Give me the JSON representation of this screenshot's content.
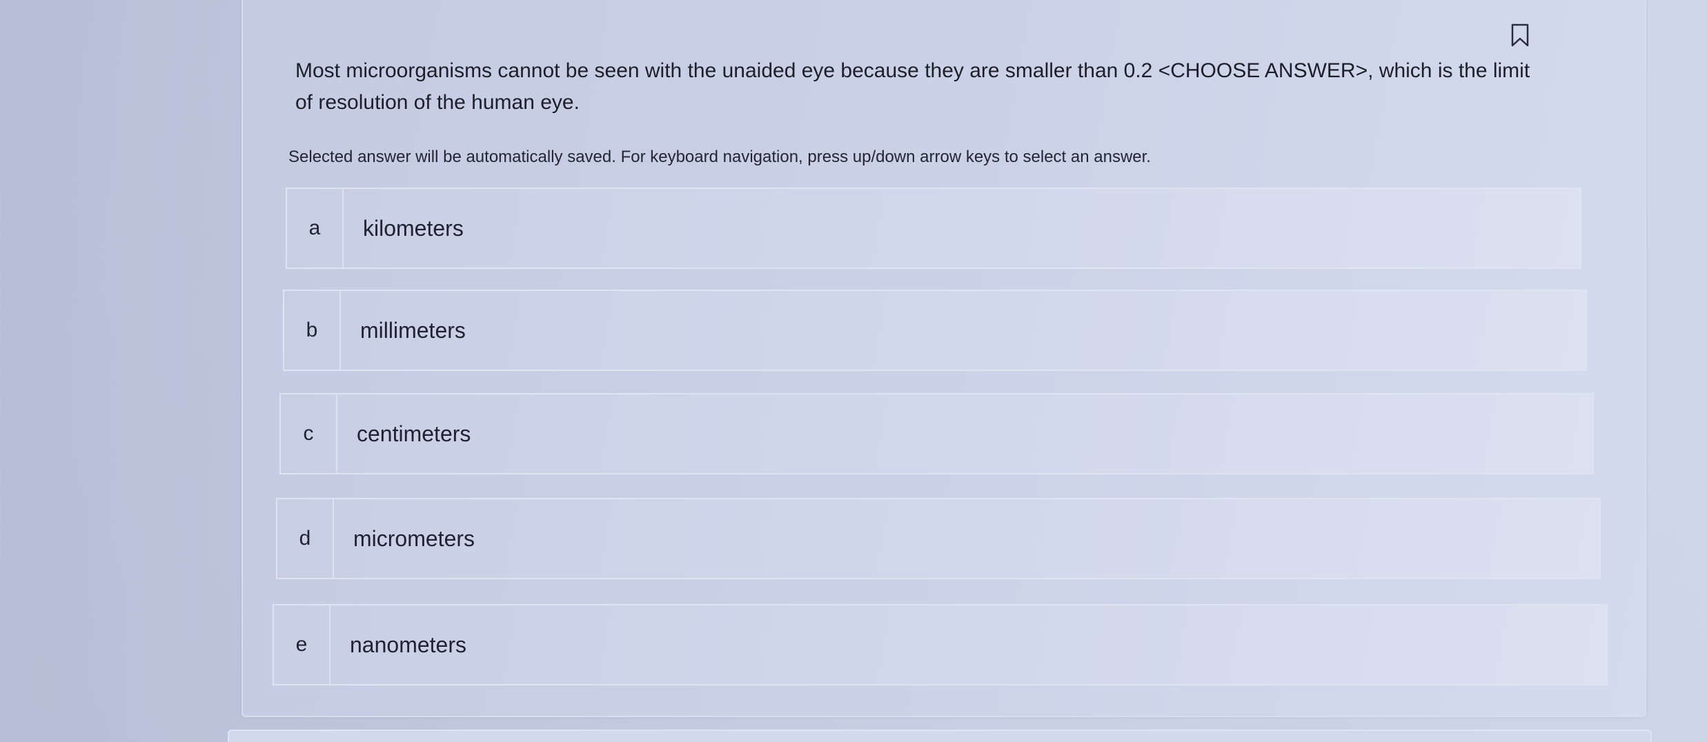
{
  "question": {
    "text": "Most microorganisms cannot be seen with the unaided eye because they are smaller than 0.2 <CHOOSE ANSWER>, which is the limit of resolution of the human eye."
  },
  "instructions": "Selected answer will be automatically saved. For keyboard navigation, press up/down arrow keys to select an answer.",
  "options": [
    {
      "letter": "a",
      "label": "kilometers"
    },
    {
      "letter": "b",
      "label": "millimeters"
    },
    {
      "letter": "c",
      "label": "centimeters"
    },
    {
      "letter": "d",
      "label": "micrometers"
    },
    {
      "letter": "e",
      "label": "nanometers"
    }
  ],
  "icons": {
    "bookmark": "bookmark-icon"
  },
  "colors": {
    "text": "#1f2230",
    "card_background": "#cbd2e7",
    "border": "#dfe4f1"
  }
}
